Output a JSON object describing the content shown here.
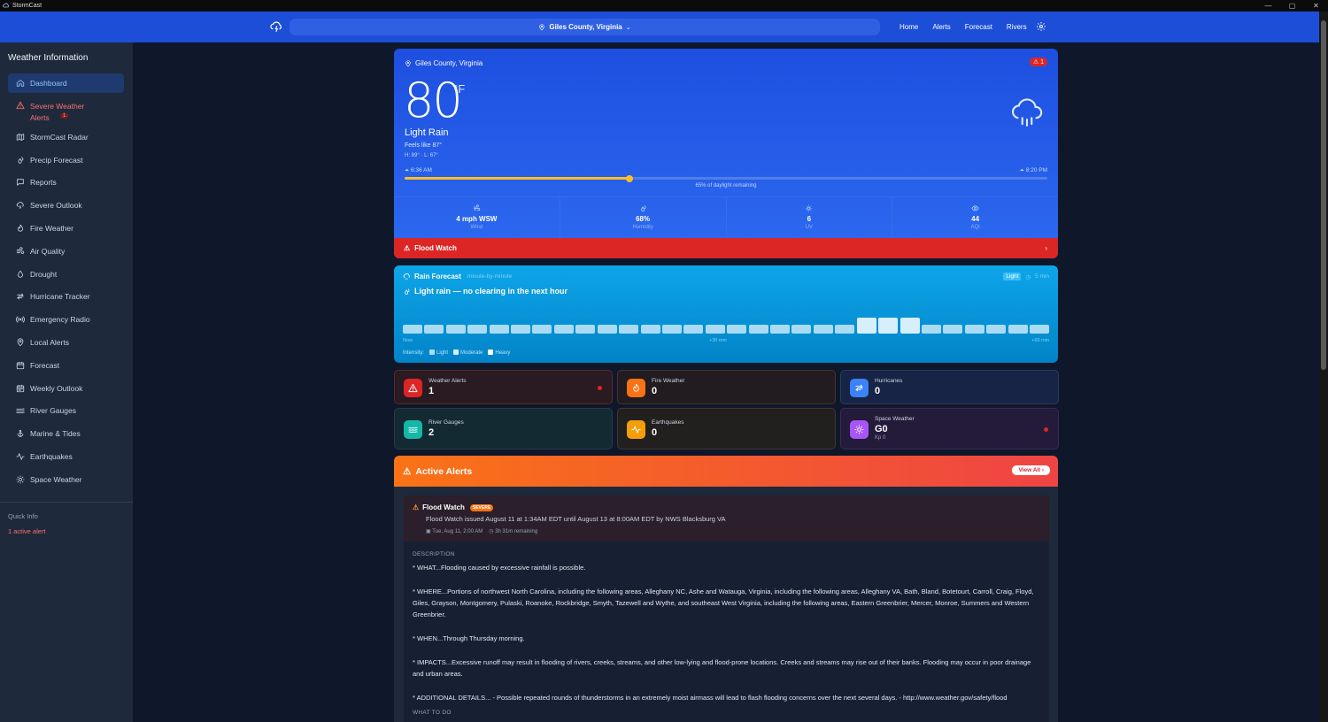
{
  "window": {
    "title": "StormCast",
    "controls": [
      "—",
      "▢",
      "✕"
    ]
  },
  "topnav": {
    "location": "Giles County, Virginia",
    "links": [
      "Home",
      "Alerts",
      "Forecast",
      "Rivers"
    ]
  },
  "sidebar": {
    "title": "Weather Information",
    "items": [
      {
        "label": "Dashboard",
        "icon": "home-icon"
      },
      {
        "label": "Severe Weather Alerts",
        "icon": "warning-icon",
        "badge": "1"
      },
      {
        "label": "StormCast Radar",
        "icon": "map-icon"
      },
      {
        "label": "Precip Forecast",
        "icon": "droplets-icon"
      },
      {
        "label": "Reports",
        "icon": "message-icon"
      },
      {
        "label": "Severe Outlook",
        "icon": "storm-icon"
      },
      {
        "label": "Fire Weather",
        "icon": "flame-icon"
      },
      {
        "label": "Air Quality",
        "icon": "wind-icon"
      },
      {
        "label": "Drought",
        "icon": "drop-icon"
      },
      {
        "label": "Hurricane Tracker",
        "icon": "hurricane-icon"
      },
      {
        "label": "Emergency Radio",
        "icon": "radio-icon"
      },
      {
        "label": "Local Alerts",
        "icon": "pin-icon"
      },
      {
        "label": "Forecast",
        "icon": "calendar-icon"
      },
      {
        "label": "Weekly Outlook",
        "icon": "calendar-week-icon"
      },
      {
        "label": "River Gauges",
        "icon": "waves-icon"
      },
      {
        "label": "Marine & Tides",
        "icon": "anchor-icon"
      },
      {
        "label": "Earthquakes",
        "icon": "activity-icon"
      },
      {
        "label": "Space Weather",
        "icon": "sun-icon"
      }
    ],
    "quick_info_title": "Quick Info",
    "quick_info_value": "1 active alert"
  },
  "current": {
    "location": "Giles County, Virginia",
    "alert_count": "1",
    "temp": "80",
    "unit": "°F",
    "condition": "Light Rain",
    "feels_like": "Feels like 87°",
    "hilo": "H: 89° · L: 67°",
    "sunrise": "6:36 AM",
    "sunset": "8:20 PM",
    "daylight_fraction": 0.35,
    "daylight_text": "65% of daylight remaining",
    "stats": [
      {
        "value": "4 mph WSW",
        "label": "Wind",
        "icon": "wind-icon"
      },
      {
        "value": "68%",
        "label": "Humidity",
        "icon": "droplets-icon"
      },
      {
        "value": "6",
        "label": "UV",
        "icon": "sun-icon"
      },
      {
        "value": "44",
        "label": "AQI",
        "icon": "eye-icon"
      }
    ],
    "banner": "Flood Watch"
  },
  "rain": {
    "title": "Rain Forecast",
    "subtitle": "minute-by-minute",
    "intensity_badge": "Light",
    "interval": "5 min",
    "headline": "Light rain — no clearing in the next hour",
    "bars": [
      1,
      1,
      1,
      1,
      1,
      1,
      1,
      1,
      1,
      1,
      1,
      1,
      1,
      1,
      1,
      1,
      1,
      1,
      1,
      1,
      1,
      2,
      2,
      2,
      1,
      1,
      1,
      1,
      1,
      1
    ],
    "axis_now": "Now",
    "axis_mid": "+30 min",
    "axis_end": "+60 min",
    "legend_label": "Intensity:",
    "legend": [
      {
        "label": "Light",
        "color": "#a9dcf4"
      },
      {
        "label": "Moderate",
        "color": "#d6effb"
      },
      {
        "label": "Heavy",
        "color": "#ffffff"
      }
    ]
  },
  "cards": [
    {
      "title": "Weather Alerts",
      "value": "1",
      "sub": "",
      "color": "#dc2626",
      "bg": "#2a1a22",
      "border": "#5a2a2a",
      "dot": true,
      "icon": "warning-icon"
    },
    {
      "title": "Fire Weather",
      "value": "0",
      "sub": "",
      "color": "#f97316",
      "bg": "#221c20",
      "border": "#4a3030",
      "dot": false,
      "icon": "flame-icon"
    },
    {
      "title": "Hurricanes",
      "value": "0",
      "sub": "",
      "color": "#3b82f6",
      "bg": "#172445",
      "border": "#2a3a5e",
      "dot": false,
      "icon": "hurricane-icon"
    },
    {
      "title": "River Gauges",
      "value": "2",
      "sub": "",
      "color": "#14b8a6",
      "bg": "#142a33",
      "border": "#2a3a45",
      "dot": false,
      "icon": "waves-icon"
    },
    {
      "title": "Earthquakes",
      "value": "0",
      "sub": "",
      "color": "#f59e0b",
      "bg": "#22201e",
      "border": "#403530",
      "dot": false,
      "icon": "activity-icon"
    },
    {
      "title": "Space Weather",
      "value": "G0",
      "sub": "Kp 0",
      "color": "#a855f7",
      "bg": "#241a3a",
      "border": "#3a2a55",
      "dot": true,
      "icon": "sun-icon"
    }
  ],
  "active_alerts": {
    "title": "Active Alerts",
    "view_all": "View All",
    "alert": {
      "title": "Flood Watch",
      "severity": "SEVERE",
      "issued": "Flood Watch issued August 11 at 1:34AM EDT until August 13 at 8:00AM EDT by NWS Blacksburg VA",
      "time": "Tue, Aug 11, 2:00 AM",
      "remaining": "3h 31m remaining",
      "desc_label": "DESCRIPTION",
      "paragraphs": [
        "* WHAT...Flooding caused by excessive rainfall is possible.",
        "* WHERE...Portions of northwest North Carolina, including the following areas, Alleghany NC, Ashe and Watauga, Virginia, including the following areas, Alleghany VA, Bath, Bland, Botetourt, Carroll, Craig, Floyd, Giles, Grayson, Montgomery, Pulaski, Roanoke, Rockbridge, Smyth, Tazewell and Wythe, and southeast West Virginia, including the following areas, Eastern Greenbrier, Mercer, Monroe, Summers and Western Greenbrier.",
        "* WHEN...Through Thursday morning.",
        "* IMPACTS...Excessive runoff may result in flooding of rivers, creeks, streams, and other low-lying and flood-prone locations. Creeks and streams may rise out of their banks. Flooding may occur in poor drainage and urban areas.",
        "* ADDITIONAL DETAILS... - Possible repeated rounds of thunderstorms in an extremely moist airmass will lead to flash flooding concerns over the next several days. - http://www.weather.gov/safety/flood"
      ],
      "what_to_do": "WHAT TO DO"
    }
  }
}
